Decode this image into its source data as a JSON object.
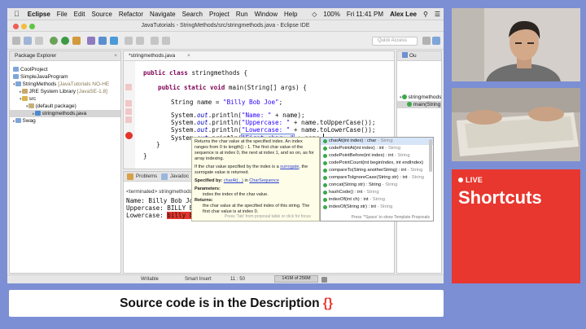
{
  "menubar": {
    "app": "Eclipse",
    "items": [
      "File",
      "Edit",
      "Source",
      "Refactor",
      "Navigate",
      "Search",
      "Project",
      "Run",
      "Window",
      "Help"
    ],
    "battery": "100%",
    "clock": "Fri 11:41 PM",
    "user": "Alex Lee"
  },
  "window": {
    "title": "JavaTutorials - StringMethods/src/stringmethods.java - Eclipse IDE"
  },
  "toolbar": {
    "quick_access_placeholder": "Quick Access"
  },
  "package_explorer": {
    "tab": "Package Explorer",
    "items": [
      {
        "label": "CoolProject",
        "indent": 0
      },
      {
        "label": "SimpleJavaProgram",
        "indent": 0
      },
      {
        "label": "StringMethods",
        "suffix": "[JavaTutorials NO-HE",
        "indent": 0
      },
      {
        "label": "JRE System Library",
        "suffix": "[JavaSE-1.8]",
        "indent": 1
      },
      {
        "label": "src",
        "indent": 1
      },
      {
        "label": "(default package)",
        "indent": 2
      },
      {
        "label": "stringmethods.java",
        "indent": 3
      },
      {
        "label": "Swag",
        "indent": 0
      }
    ]
  },
  "editor": {
    "tab": "*stringmethods.java",
    "lines": {
      "l1_kw": "public class",
      "l1_rest": " stringmethods {",
      "l2_kw": "public static void",
      "l2_rest": " main(String[] args) {",
      "l3_pre": "String name = ",
      "l3_str": "\"Billy Bob Joe\"",
      "l3_post": ";",
      "l4_pre": "System.",
      "l4_fld": "out",
      "l4_mid": ".println(",
      "l4_str": "\"Name: \"",
      "l4_post": " + name);",
      "l5_pre": "System.",
      "l5_fld": "out",
      "l5_mid": ".println(",
      "l5_str": "\"Uppercase: \"",
      "l5_post": " + name.toUpperCase());",
      "l6_pre": "System.",
      "l6_fld": "out",
      "l6_mid": ".println(",
      "l6_str": "\"Lowercase: \"",
      "l6_post": " + name.toLowerCase());",
      "l7_pre": "System.",
      "l7_fld": "out",
      "l7_mid": ".println(",
      "l7_str": "\"First char: \"",
      "l7_post": " + name.",
      "l8": "}",
      "l9": "}"
    }
  },
  "javadoc": {
    "p1": "Returns the char value at the specified index. An index ranges from 0 to length() - 1. The first char value of the sequence is at index 0, the next at index 1, and so on, as for array indexing.",
    "p2a": "If the char value specified by the index is a ",
    "p2link": "surrogate",
    "p2b": ", the surrogate value is returned.",
    "spec_label": "Specified by:",
    "spec_link1": "charAt(...)",
    "spec_in": " in ",
    "spec_link2": "CharSequence",
    "params_label": "Parameters:",
    "param": "index the index of the char value.",
    "returns_label": "Returns:",
    "returns": "the char value at the specified index of this string. The first char value is at index 0.",
    "footer": "Press 'Tab' from proposal table or click for focus"
  },
  "proposals": {
    "items": [
      {
        "sig": "charAt(int index) : char",
        "type": " - String"
      },
      {
        "sig": "codePointAt(int index) : int",
        "type": " - String"
      },
      {
        "sig": "codePointBefore(int index) : int",
        "type": " - String"
      },
      {
        "sig": "codePointCount(int beginIndex, int endIndex)",
        "type": ""
      },
      {
        "sig": "compareTo(String anotherString) : int",
        "type": " - String"
      },
      {
        "sig": "compareToIgnoreCase(String str) : int",
        "type": " - String"
      },
      {
        "sig": "concat(String str) : String",
        "type": " - String"
      },
      {
        "sig": "hashCode() : int",
        "type": " - String"
      },
      {
        "sig": "indexOf(int ch) : int",
        "type": " - String"
      },
      {
        "sig": "indexOf(String str) : int",
        "type": " - String"
      }
    ],
    "footer": "Press '^Space' to show Template Proposals"
  },
  "console": {
    "tabs": {
      "problems": "Problems",
      "javadoc": "Javadoc"
    },
    "terminated": "<terminated> stringmethods",
    "out1": "Name: Billy Bob Jo",
    "out2": "Uppercase: BILLY B",
    "out3_pre": "Lowercase: ",
    "out3_hl": "billy b"
  },
  "outline": {
    "tab": "Ou",
    "class_item": "stringmethods",
    "method_item": "main(String"
  },
  "status": {
    "writable": "Writable",
    "insert_mode": "Smart Insert",
    "position": "11 : 50",
    "heap": "141M of 256M"
  },
  "live_card": {
    "badge": "LIVE",
    "title": "Shortcuts"
  },
  "banner": {
    "text": "Source code is in the Description ",
    "braces": "{}"
  },
  "colors": {
    "background": "#7c8fd4",
    "accent": "#e8372f",
    "keyword": "#7f0055",
    "string": "#2a00ff"
  }
}
